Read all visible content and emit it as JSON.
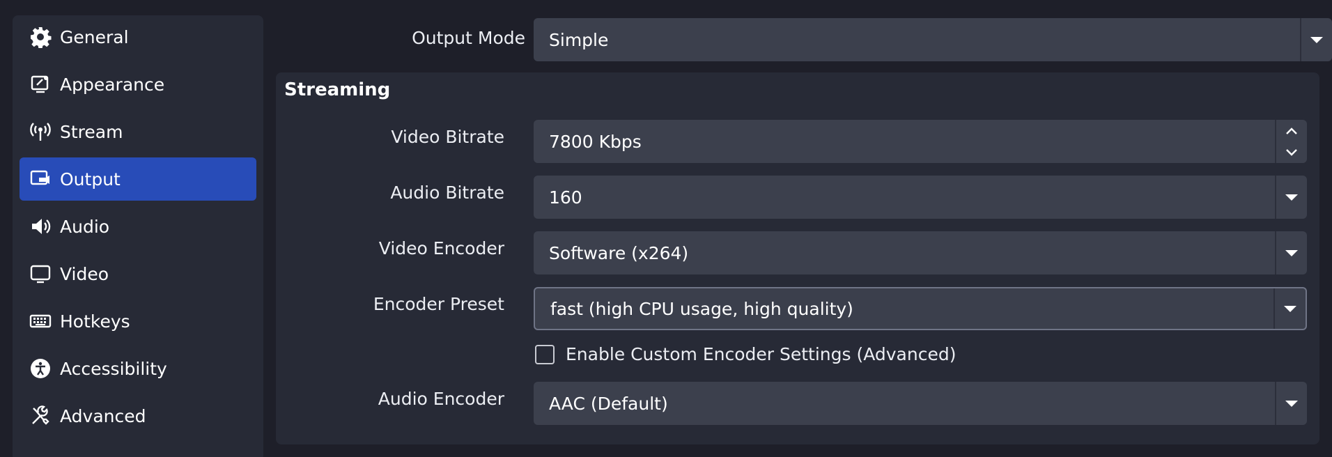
{
  "sidebar": {
    "items": [
      {
        "label": "General",
        "icon": "gear-icon"
      },
      {
        "label": "Appearance",
        "icon": "appearance-icon"
      },
      {
        "label": "Stream",
        "icon": "antenna-icon"
      },
      {
        "label": "Output",
        "icon": "output-icon",
        "active": true
      },
      {
        "label": "Audio",
        "icon": "speaker-icon"
      },
      {
        "label": "Video",
        "icon": "monitor-icon"
      },
      {
        "label": "Hotkeys",
        "icon": "keyboard-icon"
      },
      {
        "label": "Accessibility",
        "icon": "accessibility-icon"
      },
      {
        "label": "Advanced",
        "icon": "tools-icon"
      }
    ]
  },
  "output_mode": {
    "label": "Output Mode",
    "value": "Simple"
  },
  "streaming": {
    "title": "Streaming",
    "video_bitrate": {
      "label": "Video Bitrate",
      "value": "7800 Kbps"
    },
    "audio_bitrate": {
      "label": "Audio Bitrate",
      "value": "160"
    },
    "video_encoder": {
      "label": "Video Encoder",
      "value": "Software (x264)"
    },
    "encoder_preset": {
      "label": "Encoder Preset",
      "value": "fast (high CPU usage, high quality)"
    },
    "custom_encoder": {
      "label": "Enable Custom Encoder Settings (Advanced)",
      "checked": false
    },
    "audio_encoder": {
      "label": "Audio Encoder",
      "value": "AAC (Default)"
    }
  },
  "colors": {
    "accent": "#284cb8",
    "background": "#1e1f29",
    "panel": "#272a36",
    "field": "#3c404d"
  }
}
